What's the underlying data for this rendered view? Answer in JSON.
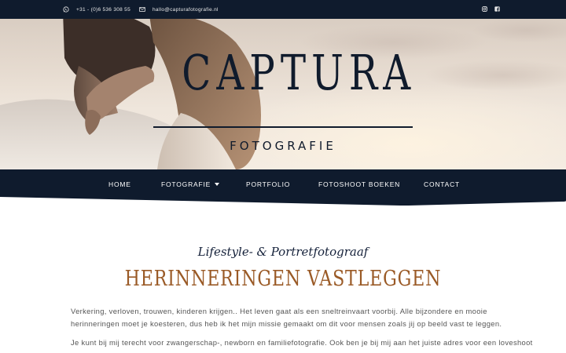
{
  "topbar": {
    "phone": "+31 - (0)6 536 308 55",
    "email": "hallo@capturafotografie.nl",
    "icons": [
      "whatsapp-icon",
      "mail-icon",
      "instagram-icon",
      "facebook-icon"
    ]
  },
  "hero": {
    "logo_title": "CAPTURA",
    "logo_subtitle": "FOTOGRAFIE"
  },
  "nav": {
    "items": [
      {
        "label": "HOME"
      },
      {
        "label": "FOTOGRAFIE"
      },
      {
        "label": "PORTFOLIO"
      },
      {
        "label": "FOTOSHOOT BOEKEN"
      },
      {
        "label": "CONTACT"
      }
    ]
  },
  "content": {
    "tagline": "Lifestyle- & Portretfotograaf",
    "headline": "HERINNERINGEN VASTLEGGEN",
    "paragraph1": [
      "Verkering, verloven, trouwen, kinderen krijgen.. Het leven gaat als een sneltreinvaart voorbij. Alle bijzondere en mooie",
      "herinneringen moet je koesteren, dus heb ik het mijn missie gemaakt om dit voor mensen zoals jij op beeld vast te leggen."
    ],
    "paragraph2": [
      "Je kunt bij mij terecht voor zwangerschap-, newborn en familiefotografie. Ook ben je bij mij aan het juiste adres voor een loveshoot"
    ]
  },
  "colors": {
    "navy": "#0f1b2d",
    "accent": "#9a5a26"
  }
}
